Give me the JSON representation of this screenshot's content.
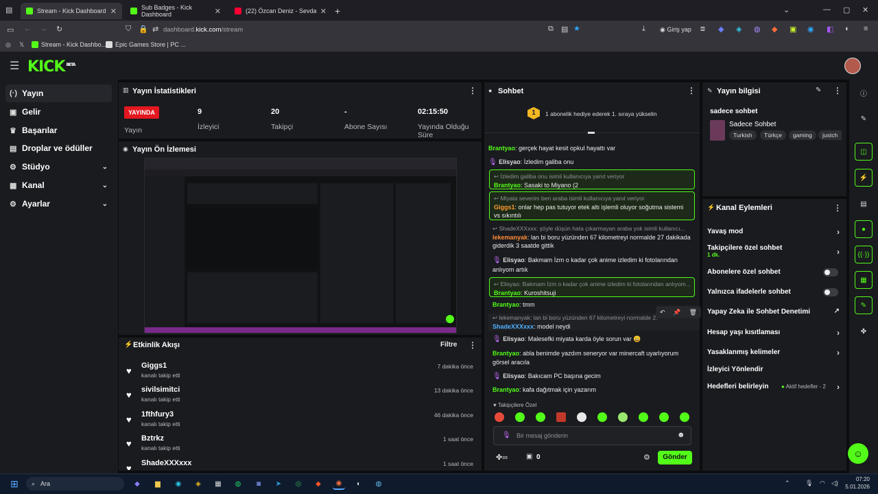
{
  "browser": {
    "tabs": [
      {
        "title": "Stream - Kick Dashboard",
        "fav": "#53fc18"
      },
      {
        "title": "Sub Badges - Kick Dashboard",
        "fav": "#53fc18"
      },
      {
        "title": "(22) Özcan Deniz - Sevdan...",
        "fav": "#ff0033"
      }
    ],
    "url_prefix": "dashboard.",
    "url_domain": "kick.com",
    "url_path": "/stream",
    "login_label": "Giriş yap",
    "bookmarks": [
      "Stream - Kick Dashbo...",
      "Epic Games Store | PC ..."
    ]
  },
  "kick": {
    "logo": "KICK",
    "beta": "BETA"
  },
  "sidebar": {
    "items": [
      {
        "label": "Yayın",
        "icon": "broadcast-icon",
        "glyph": "((·))",
        "chev": false
      },
      {
        "label": "Gelir",
        "icon": "revenue-icon",
        "glyph": "▣",
        "chev": false
      },
      {
        "label": "Başarılar",
        "icon": "trophy-icon",
        "glyph": "🏆",
        "chev": false
      },
      {
        "label": "Droplar ve ödüller",
        "icon": "gift-icon",
        "glyph": "🎁",
        "chev": false
      },
      {
        "label": "Stüdyo",
        "icon": "studio-icon",
        "glyph": "⚙",
        "chev": true
      },
      {
        "label": "Kanal",
        "icon": "channel-icon",
        "glyph": "▦",
        "chev": true
      },
      {
        "label": "Ayarlar",
        "icon": "settings-icon",
        "glyph": "⚙",
        "chev": true
      }
    ]
  },
  "stats": {
    "title": "Yayın İstatistikleri",
    "live": "YAYINDA",
    "live_label": "Yayın",
    "viewers": "9",
    "viewers_label": "İzleyici",
    "followers": "20",
    "followers_label": "Takipçi",
    "subs": "-",
    "subs_label": "Abone Sayısı",
    "uptime": "02:15:50",
    "uptime_label": "Yayında Olduğu Süre"
  },
  "preview": {
    "title": "Yayın Ön İzlemesi"
  },
  "activity": {
    "title": "Etkinlik Akışı",
    "filter": "Filtre",
    "items": [
      {
        "name": "Giggs1",
        "action": "kanalı takip etti",
        "time": "7 dakika önce"
      },
      {
        "name": "sivilsimitci",
        "action": "kanalı takip etti",
        "time": "13 dakika önce"
      },
      {
        "name": "1fthfury3",
        "action": "kanalı takip etti",
        "time": "46 dakika önce"
      },
      {
        "name": "Bztrkz",
        "action": "kanalı takip etti",
        "time": "1 saat önce"
      },
      {
        "name": "ShadeXXXxxx",
        "action": "",
        "time": "1 saat önce"
      }
    ]
  },
  "chat": {
    "title": "Sohbet",
    "pinned": "1 abonelik hediye ederek 1. sıraya yükselin",
    "pinned_num": "1",
    "m1_user": "Brantyao",
    "m1_text": ": gerçek hayat kesit opkul hayattı var",
    "m2_user": "Elisyao",
    "m2_text": ": İzledim galiba onu",
    "m3_reply": "İzledim galiba onu isimli kullanıcıya yanıt veriyor",
    "m3_user": "Brantyao",
    "m3_text": ": Sasaki to Miyano (2",
    "m4_reply": "Miyata severim ben araba isimli kullanıcıya yanıt veriyor",
    "m4_user": "Giggs1",
    "m4_text": ": onlar hep pas tutuyor etek altı işlemli oluyor soğutma sistemi vs sıkıntılı",
    "m5_reply": "ShadeXXXxxx: şöyle düşün hata çıkarmayan araba yok isimli kullanıcı...",
    "m5_user": "lekemanyak",
    "m5_text": ": lan bi boru yüzünden 67 kilometreyi normalde 27 dakikada giderdik 3 saatde gittik",
    "m6_user": "Elisyao",
    "m6_text": ": Bakmam İzm o kadar çok anime izledim ki fotolarından anlıyom artık",
    "m7_reply": "Elisyao: Bakmam İzm o kadar çok anime izledim ki fotolarından anlıyom...",
    "m7_user": "Brantyao",
    "m7_text": ": Kuroshitsuji",
    "m8_user": "Brantyao",
    "m8_text": ": tmm",
    "m9_reply": "lekemanyak: lan bi boru yüzünden 67 kilometreyi normalde 2...",
    "m9_user": "ShadeXXXxxx",
    "m9_text": ": model neydi",
    "m10_user": "Elisyao",
    "m10_text": ": Malesefki miyata karda öyle sorun var 😄",
    "m11_user": "Brantyao",
    "m11_text": ": abla benimde yazdım seneryor var minercaft uyarlıyorum görsel aracıla",
    "m12_user": "Elisyao",
    "m12_text": ": Bakıcam PC başına gecim",
    "m13_user": "Brantyao",
    "m13_text": ": kafa dağıtmak için yazarım",
    "emote_label": "Takipçilere Özel",
    "input_placeholder": "Bir mesaj gönderin",
    "count": "0",
    "send": "Gönder"
  },
  "info": {
    "title": "Yayın bilgisi",
    "stream_title": "sadece sohbet",
    "category": "Sadece Sohbet",
    "tags": [
      "Turkish",
      "Türkçe",
      "gaming",
      "justch"
    ]
  },
  "actions": {
    "title": "Kanal Eylemleri",
    "slow": "Yavaş mod",
    "followers_only": "Takipçilere özel sohbet",
    "followers_only_sub": "1 dk.",
    "subs_only": "Abonelere özel sohbet",
    "emotes_only": "Yalnızca ifadelerle sohbet",
    "ai_mod": "Yapay Zeka ile Sohbet Denetimi",
    "age": "Hesap yaşı kısıtlaması",
    "banned": "Yasaklanmış kelimeler",
    "redirect": "İzleyici Yönlendir",
    "goals": "Hedefleri belirleyin",
    "goals_status": "Aktif hedefler - 2"
  },
  "taskbar": {
    "search": "Ara",
    "time": "07:20",
    "date": "5.01.2026"
  }
}
